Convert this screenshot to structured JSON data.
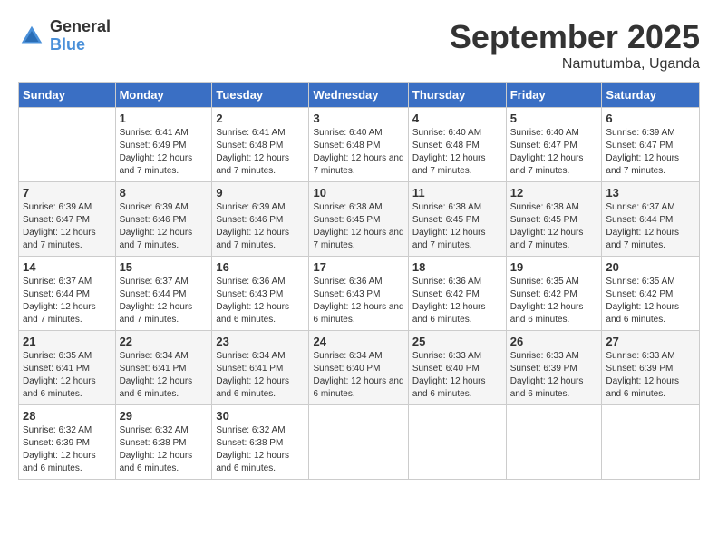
{
  "logo": {
    "general": "General",
    "blue": "Blue"
  },
  "title": "September 2025",
  "location": "Namutumba, Uganda",
  "headers": [
    "Sunday",
    "Monday",
    "Tuesday",
    "Wednesday",
    "Thursday",
    "Friday",
    "Saturday"
  ],
  "weeks": [
    [
      {
        "day": "",
        "sunrise": "",
        "sunset": "",
        "daylight": ""
      },
      {
        "day": "1",
        "sunrise": "6:41 AM",
        "sunset": "6:49 PM",
        "daylight": "12 hours and 7 minutes."
      },
      {
        "day": "2",
        "sunrise": "6:41 AM",
        "sunset": "6:48 PM",
        "daylight": "12 hours and 7 minutes."
      },
      {
        "day": "3",
        "sunrise": "6:40 AM",
        "sunset": "6:48 PM",
        "daylight": "12 hours and 7 minutes."
      },
      {
        "day": "4",
        "sunrise": "6:40 AM",
        "sunset": "6:48 PM",
        "daylight": "12 hours and 7 minutes."
      },
      {
        "day": "5",
        "sunrise": "6:40 AM",
        "sunset": "6:47 PM",
        "daylight": "12 hours and 7 minutes."
      },
      {
        "day": "6",
        "sunrise": "6:39 AM",
        "sunset": "6:47 PM",
        "daylight": "12 hours and 7 minutes."
      }
    ],
    [
      {
        "day": "7",
        "sunrise": "6:39 AM",
        "sunset": "6:47 PM",
        "daylight": "12 hours and 7 minutes."
      },
      {
        "day": "8",
        "sunrise": "6:39 AM",
        "sunset": "6:46 PM",
        "daylight": "12 hours and 7 minutes."
      },
      {
        "day": "9",
        "sunrise": "6:39 AM",
        "sunset": "6:46 PM",
        "daylight": "12 hours and 7 minutes."
      },
      {
        "day": "10",
        "sunrise": "6:38 AM",
        "sunset": "6:45 PM",
        "daylight": "12 hours and 7 minutes."
      },
      {
        "day": "11",
        "sunrise": "6:38 AM",
        "sunset": "6:45 PM",
        "daylight": "12 hours and 7 minutes."
      },
      {
        "day": "12",
        "sunrise": "6:38 AM",
        "sunset": "6:45 PM",
        "daylight": "12 hours and 7 minutes."
      },
      {
        "day": "13",
        "sunrise": "6:37 AM",
        "sunset": "6:44 PM",
        "daylight": "12 hours and 7 minutes."
      }
    ],
    [
      {
        "day": "14",
        "sunrise": "6:37 AM",
        "sunset": "6:44 PM",
        "daylight": "12 hours and 7 minutes."
      },
      {
        "day": "15",
        "sunrise": "6:37 AM",
        "sunset": "6:44 PM",
        "daylight": "12 hours and 7 minutes."
      },
      {
        "day": "16",
        "sunrise": "6:36 AM",
        "sunset": "6:43 PM",
        "daylight": "12 hours and 6 minutes."
      },
      {
        "day": "17",
        "sunrise": "6:36 AM",
        "sunset": "6:43 PM",
        "daylight": "12 hours and 6 minutes."
      },
      {
        "day": "18",
        "sunrise": "6:36 AM",
        "sunset": "6:42 PM",
        "daylight": "12 hours and 6 minutes."
      },
      {
        "day": "19",
        "sunrise": "6:35 AM",
        "sunset": "6:42 PM",
        "daylight": "12 hours and 6 minutes."
      },
      {
        "day": "20",
        "sunrise": "6:35 AM",
        "sunset": "6:42 PM",
        "daylight": "12 hours and 6 minutes."
      }
    ],
    [
      {
        "day": "21",
        "sunrise": "6:35 AM",
        "sunset": "6:41 PM",
        "daylight": "12 hours and 6 minutes."
      },
      {
        "day": "22",
        "sunrise": "6:34 AM",
        "sunset": "6:41 PM",
        "daylight": "12 hours and 6 minutes."
      },
      {
        "day": "23",
        "sunrise": "6:34 AM",
        "sunset": "6:41 PM",
        "daylight": "12 hours and 6 minutes."
      },
      {
        "day": "24",
        "sunrise": "6:34 AM",
        "sunset": "6:40 PM",
        "daylight": "12 hours and 6 minutes."
      },
      {
        "day": "25",
        "sunrise": "6:33 AM",
        "sunset": "6:40 PM",
        "daylight": "12 hours and 6 minutes."
      },
      {
        "day": "26",
        "sunrise": "6:33 AM",
        "sunset": "6:39 PM",
        "daylight": "12 hours and 6 minutes."
      },
      {
        "day": "27",
        "sunrise": "6:33 AM",
        "sunset": "6:39 PM",
        "daylight": "12 hours and 6 minutes."
      }
    ],
    [
      {
        "day": "28",
        "sunrise": "6:32 AM",
        "sunset": "6:39 PM",
        "daylight": "12 hours and 6 minutes."
      },
      {
        "day": "29",
        "sunrise": "6:32 AM",
        "sunset": "6:38 PM",
        "daylight": "12 hours and 6 minutes."
      },
      {
        "day": "30",
        "sunrise": "6:32 AM",
        "sunset": "6:38 PM",
        "daylight": "12 hours and 6 minutes."
      },
      {
        "day": "",
        "sunrise": "",
        "sunset": "",
        "daylight": ""
      },
      {
        "day": "",
        "sunrise": "",
        "sunset": "",
        "daylight": ""
      },
      {
        "day": "",
        "sunrise": "",
        "sunset": "",
        "daylight": ""
      },
      {
        "day": "",
        "sunrise": "",
        "sunset": "",
        "daylight": ""
      }
    ]
  ]
}
